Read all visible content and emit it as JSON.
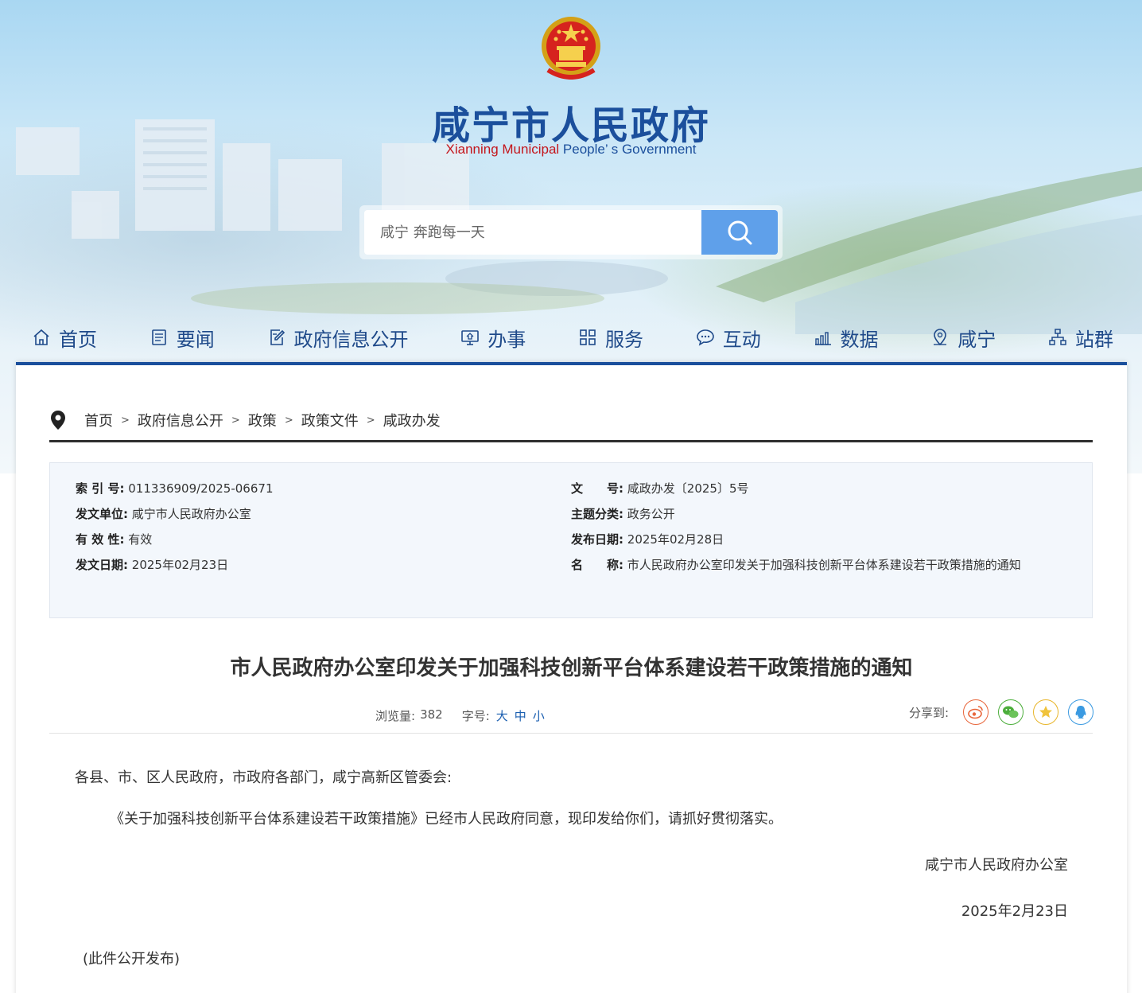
{
  "header": {
    "title": "咸宁市人民政府",
    "subtitle_red": "Xianning Municipal",
    "subtitle_blue": " People’ s Government"
  },
  "search": {
    "placeholder": "咸宁 奔跑每一天"
  },
  "nav": [
    {
      "label": "首页",
      "icon": "home-icon"
    },
    {
      "label": "要闻",
      "icon": "news-icon"
    },
    {
      "label": "政府信息公开",
      "icon": "document-edit-icon"
    },
    {
      "label": "办事",
      "icon": "monitor-icon"
    },
    {
      "label": "服务",
      "icon": "grid-icon"
    },
    {
      "label": "互动",
      "icon": "chat-icon"
    },
    {
      "label": "数据",
      "icon": "bar-chart-icon"
    },
    {
      "label": "咸宁",
      "icon": "location-icon"
    },
    {
      "label": "站群",
      "icon": "sitemap-icon"
    }
  ],
  "breadcrumb": [
    "首页",
    "政府信息公开",
    "政策",
    "政策文件",
    "咸政办发"
  ],
  "breadcrumb_sep": ">",
  "meta": {
    "index_label": "索 引 号:",
    "index_value": "011336909/2025-06671",
    "issuer_label": "发文单位:",
    "issuer_value": "咸宁市人民政府办公室",
    "validity_label": "有 效 性:",
    "validity_value": "有效",
    "issue_date_label": "发文日期:",
    "issue_date_value": "2025年02月23日",
    "docno_label": "文　　号:",
    "docno_value": "咸政办发〔2025〕5号",
    "topic_label": "主题分类:",
    "topic_value": "政务公开",
    "publish_label": "发布日期:",
    "publish_value": "2025年02月28日",
    "name_label": "名　　称:",
    "name_value": "市人民政府办公室印发关于加强科技创新平台体系建设若干政策措施的通知"
  },
  "doc": {
    "title": "市人民政府办公室印发关于加强科技创新平台体系建设若干政策措施的通知",
    "views_label": "浏览量:",
    "views_value": "382",
    "fontsize_label": "字号:",
    "size_large": "大",
    "size_medium": "中",
    "size_small": "小",
    "share_label": "分享到:",
    "salutation": "各县、市、区人民政府，市政府各部门，咸宁高新区管委会:",
    "paragraph": "《关于加强科技创新平台体系建设若干政策措施》已经市人民政府同意，现印发给你们，请抓好贯彻落实。",
    "signature": "咸宁市人民政府办公室",
    "date": "2025年2月23日",
    "note": "(此件公开发布)"
  },
  "colors": {
    "brand_blue": "#1b4f9c",
    "accent_red": "#c4161c",
    "search_button": "#5fa0ea"
  }
}
